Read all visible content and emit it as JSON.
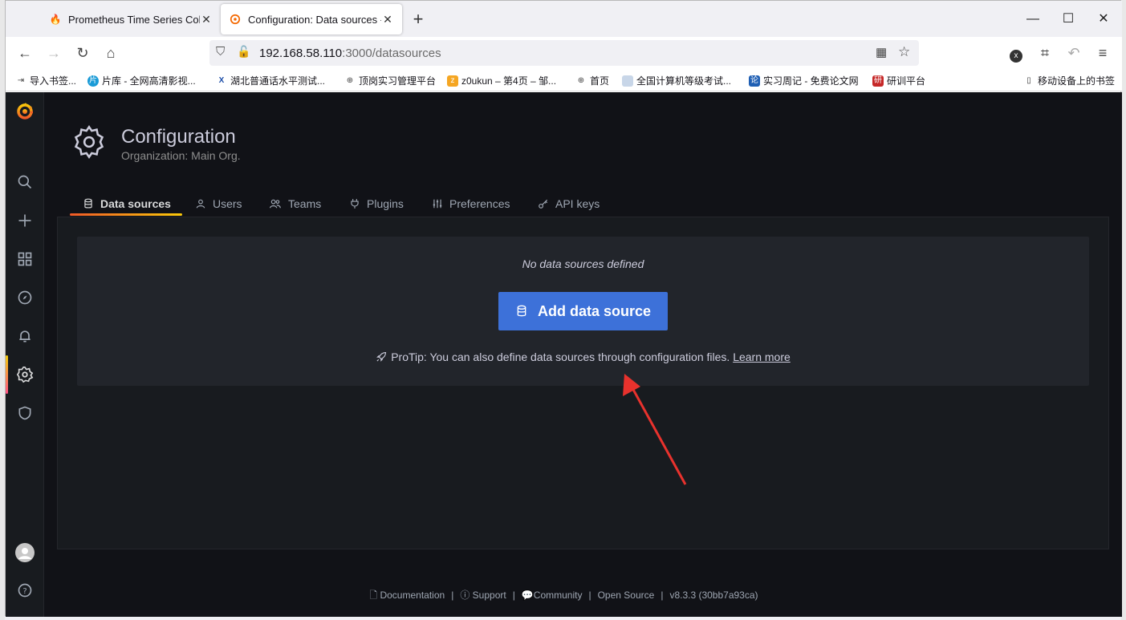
{
  "browser": {
    "tabs": [
      {
        "title": "Prometheus Time Series Colle",
        "icon": "prometheus-flame-icon"
      },
      {
        "title": "Configuration: Data sources -",
        "icon": "grafana-icon"
      }
    ],
    "url_host": "192.168.58.110",
    "url_rest": ":3000/datasources",
    "bookmarks": [
      "导入书签...",
      "片库 - 全网高清影视...",
      "湖北普通话水平测试...",
      "顶岗实习管理平台",
      "z0ukun – 第4页 – 邹...",
      "首页",
      "全国计算机等级考试...",
      "实习周记 - 免费论文网",
      "研训平台",
      "移动设备上的书签"
    ]
  },
  "page": {
    "title": "Configuration",
    "subtitle": "Organization: Main Org."
  },
  "tabs": [
    {
      "label": "Data sources",
      "icon": "database-icon"
    },
    {
      "label": "Users",
      "icon": "user-icon"
    },
    {
      "label": "Teams",
      "icon": "users-icon"
    },
    {
      "label": "Plugins",
      "icon": "plug-icon"
    },
    {
      "label": "Preferences",
      "icon": "sliders-icon"
    },
    {
      "label": "API keys",
      "icon": "key-icon"
    }
  ],
  "empty": {
    "title": "No data sources defined",
    "button": "Add data source",
    "protip": "ProTip: You can also define data sources through configuration files.",
    "learn_more": "Learn more"
  },
  "footer": {
    "documentation": "Documentation",
    "support": "Support",
    "community": "Community",
    "open_source": "Open Source",
    "version": "v8.3.3 (30bb7a93ca)"
  },
  "colors": {
    "primary_button": "#3d71d9",
    "background": "#111217",
    "annotation_arrow": "#e8322d"
  }
}
